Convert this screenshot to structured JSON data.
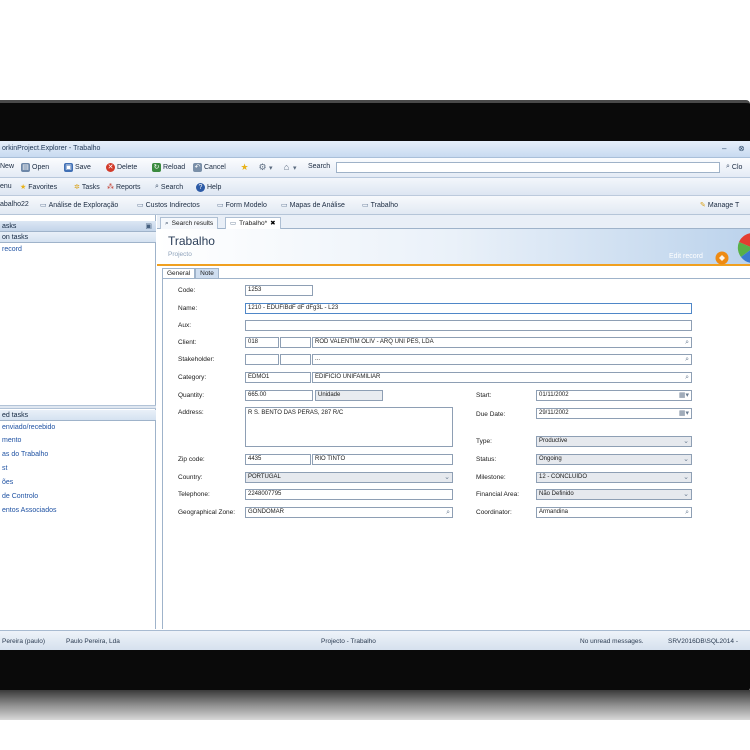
{
  "window": {
    "title": "orkinProject.Explorer - Trabalho",
    "minimize_glyph": "–",
    "close_glyph": "⊗"
  },
  "toolbar": {
    "new": "New",
    "open": "Open",
    "save": "Save",
    "delete": "Delete",
    "reload": "Reload",
    "cancel": "Cancel",
    "search": "Search",
    "right_search": "Clo"
  },
  "menubar": {
    "menu": "enu",
    "favorites": "Favorites",
    "tasks": "Tasks",
    "reports": "Reports",
    "search": "Search",
    "help": "Help"
  },
  "shortcuts": {
    "items": [
      "abalho22",
      "Análise de Exploração",
      "Custos Indirectos",
      "Form Modelo",
      "Mapas de Análise",
      "Trabalho"
    ],
    "manage": "Manage T"
  },
  "left_panel": {
    "header1": "asks",
    "section1": "on tasks",
    "link_record": "record",
    "section2": "ed tasks",
    "related": [
      "enviado/recebido",
      "mento",
      "as do Trabalho",
      "st",
      "ões",
      "de Controlo",
      "entos Associados"
    ]
  },
  "doc_tabs": {
    "search_results": "Search results",
    "trabalho": "Trabalho*"
  },
  "record": {
    "title": "Trabalho",
    "subtitle": "Projecto",
    "edit_label": "Edit record"
  },
  "form_tabs": {
    "general": "General",
    "note": "Note"
  },
  "form": {
    "code_label": "Code:",
    "code": "1253",
    "name_label": "Name:",
    "name": "1210 - EDUFíBdF dF dFg3L - L23",
    "aux_label": "Aux:",
    "aux": "",
    "client_label": "Client:",
    "client_code": "018",
    "client_name": "ROD VALENTIM OLIV - ARQ UNI PES, LDA",
    "stakeholder_label": "Stakeholder:",
    "stakeholder_name": "...",
    "category_label": "Category:",
    "category_code": "EDMO1",
    "category_name": "EDIFICIO UNIFAMILIAR",
    "quantity_label": "Quantity:",
    "quantity": "665.00",
    "unit": "Unidade",
    "address_label": "Address:",
    "address": "R S. BENTO DAS PERAS, 287 R/C",
    "zip_label": "Zip code:",
    "zip": "4435",
    "city": "RIO TINTO",
    "country_label": "Country:",
    "country": "PORTUGAL",
    "telephone_label": "Telephone:",
    "telephone": "2248007795",
    "geo_label": "Geographical Zone:",
    "geo": "GONDOMAR",
    "start_label": "Start:",
    "start": "01/11/2002",
    "due_label": "Due Date:",
    "due": "29/11/2002",
    "type_label": "Type:",
    "type": "Productive",
    "status_label": "Status:",
    "status": "Ongoing",
    "milestone_label": "Milestone:",
    "milestone": "12 - CONCLUÍDO",
    "financial_label": "Financial Area:",
    "financial": "Não Definido",
    "coordinator_label": "Coordinator:",
    "coordinator": "Armandina"
  },
  "statusbar": {
    "user": "Pereira (paulo)",
    "company": "Paulo Pereira, Lda",
    "context": "Projecto - Trabalho",
    "messages": "No unread messages.",
    "server": "SRV2016DB\\SQL2014 -"
  },
  "colors": {
    "accent": "#f0a020",
    "link": "#1f52a3",
    "banner": "#bcd3ec"
  }
}
